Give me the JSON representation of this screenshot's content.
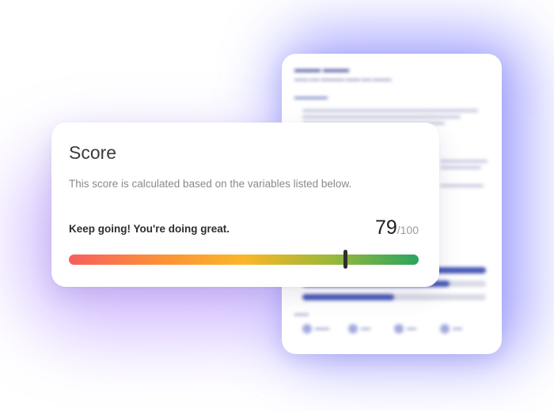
{
  "score_card": {
    "title": "Score",
    "description": "This score is calculated based on the variables listed below.",
    "message": "Keep going! You're doing great.",
    "score": "79",
    "max": "/100",
    "score_fraction": 0.79,
    "gradient_colors": [
      "#f65f5f",
      "#fb8f3a",
      "#fbb629",
      "#9bb83a",
      "#2aa55f"
    ]
  },
  "colors": {
    "glow_blue": "#8d8cff",
    "glow_purple": "#c5a8ff",
    "bg_bar_fill": "#4857b5",
    "marker": "#2f2f2f"
  },
  "background_card": {
    "bars": [
      {
        "fill_fraction": 1.0
      },
      {
        "fill_fraction": 0.8
      },
      {
        "fill_fraction": 0.5
      }
    ]
  }
}
